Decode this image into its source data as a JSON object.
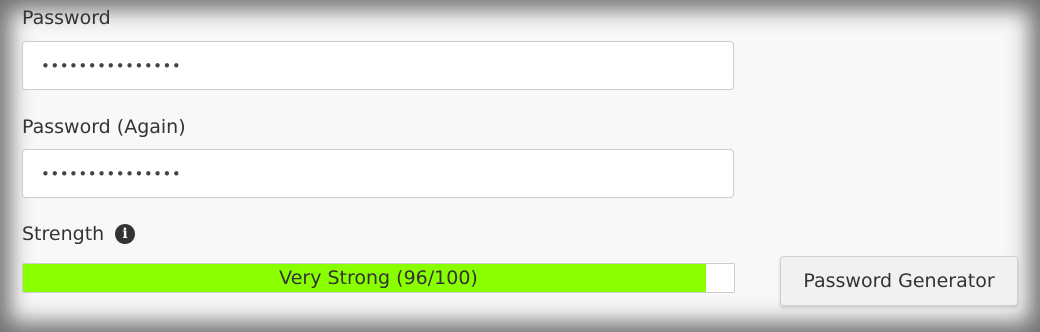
{
  "form": {
    "password_label": "Password",
    "password_value": "•••••••••••••••",
    "password_again_label": "Password (Again)",
    "password_again_value": "•••••••••••••••",
    "strength_label": "Strength",
    "strength_info_icon": "info-circle-icon",
    "strength_text": "Very Strong (96/100)",
    "strength_score": 96,
    "strength_max": 100,
    "strength_color": "#8aff00",
    "generator_button_label": "Password Generator"
  }
}
